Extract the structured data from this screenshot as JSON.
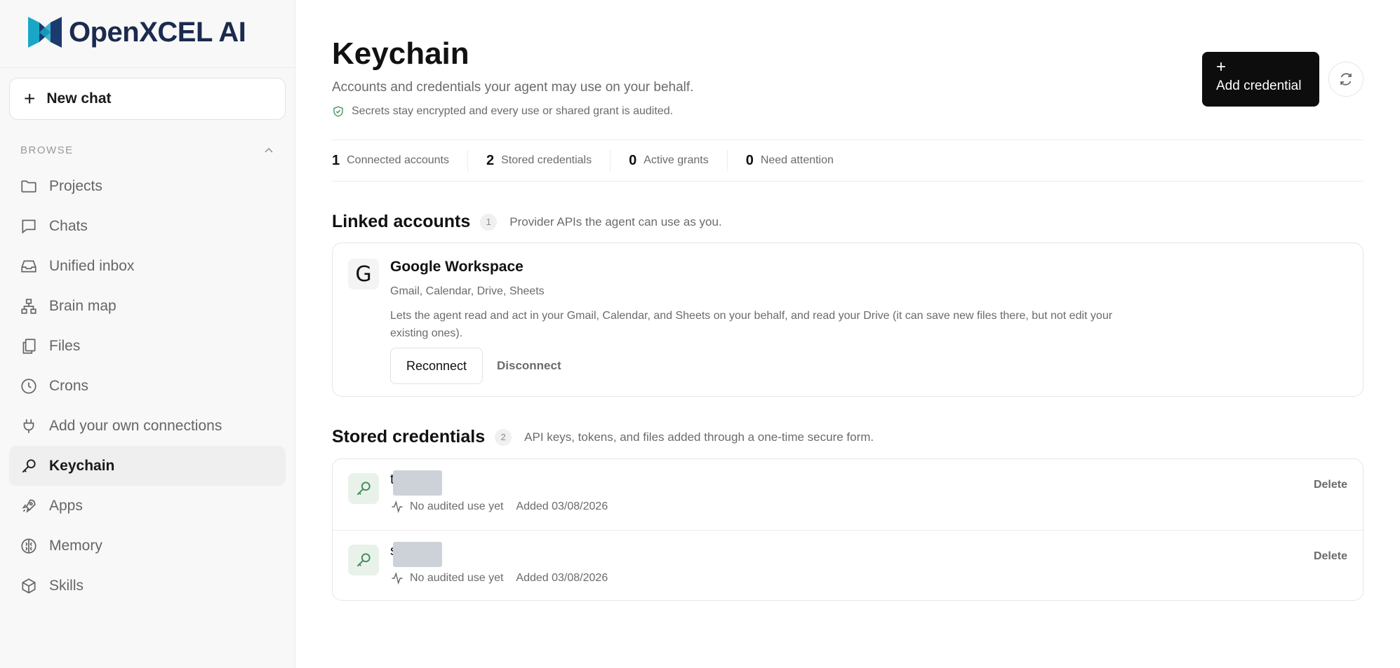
{
  "brand": {
    "name": "OpenXCEL AI",
    "accent": "#1b8fb5",
    "dark": "#1b2a4e"
  },
  "sidebar": {
    "new_chat": "New chat",
    "browse_label": "BROWSE",
    "items": [
      {
        "label": "Projects",
        "icon": "folder-icon"
      },
      {
        "label": "Chats",
        "icon": "chat-icon"
      },
      {
        "label": "Unified inbox",
        "icon": "inbox-icon"
      },
      {
        "label": "Brain map",
        "icon": "hierarchy-icon"
      },
      {
        "label": "Files",
        "icon": "files-icon"
      },
      {
        "label": "Crons",
        "icon": "clock-icon"
      },
      {
        "label": "Add your own connections",
        "icon": "plug-icon"
      },
      {
        "label": "Keychain",
        "icon": "key-icon",
        "active": true
      },
      {
        "label": "Apps",
        "icon": "rocket-icon"
      },
      {
        "label": "Memory",
        "icon": "brain-icon"
      },
      {
        "label": "Skills",
        "icon": "cube-icon"
      }
    ]
  },
  "header": {
    "title": "Keychain",
    "subtitle": "Accounts and credentials your agent may use on your behalf.",
    "audit_note": "Secrets stay encrypted and every use or shared grant is audited.",
    "add_button": "Add credential"
  },
  "stats": [
    {
      "value": "1",
      "label": "Connected accounts"
    },
    {
      "value": "2",
      "label": "Stored credentials"
    },
    {
      "value": "0",
      "label": "Active grants"
    },
    {
      "value": "0",
      "label": "Need attention"
    }
  ],
  "linked_accounts": {
    "title": "Linked accounts",
    "count": "1",
    "description": "Provider APIs the agent can use as you.",
    "items": [
      {
        "icon_letter": "G",
        "name": "Google Workspace",
        "scopes": "Gmail, Calendar, Drive, Sheets",
        "description": "Lets the agent read and act in your Gmail, Calendar, and Sheets on your behalf, and read your Drive (it can save new files there, but not edit your existing ones).",
        "reconnect_label": "Reconnect",
        "disconnect_label": "Disconnect"
      }
    ]
  },
  "stored_credentials": {
    "title": "Stored credentials",
    "count": "2",
    "description": "API keys, tokens, and files added through a one-time secure form.",
    "items": [
      {
        "name_prefix": "t",
        "usage": "No audited use yet",
        "added": "Added 03/08/2026",
        "delete_label": "Delete"
      },
      {
        "name_prefix": "s",
        "usage": "No audited use yet",
        "added": "Added 03/08/2026",
        "delete_label": "Delete"
      }
    ]
  }
}
